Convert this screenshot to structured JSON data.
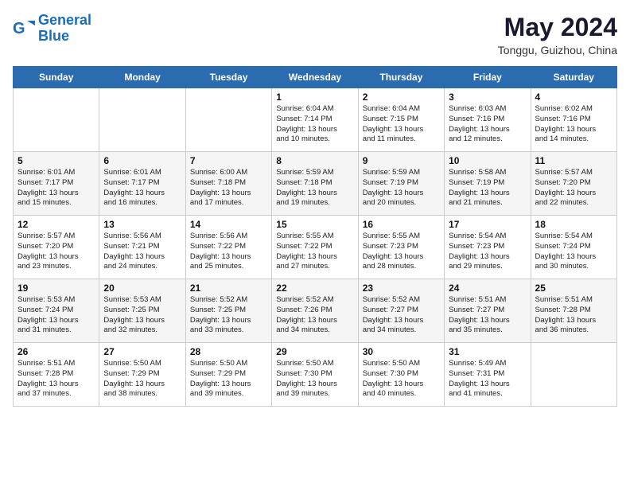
{
  "header": {
    "logo_general": "General",
    "logo_blue": "Blue",
    "month_year": "May 2024",
    "location": "Tonggu, Guizhou, China"
  },
  "weekdays": [
    "Sunday",
    "Monday",
    "Tuesday",
    "Wednesday",
    "Thursday",
    "Friday",
    "Saturday"
  ],
  "weeks": [
    [
      {
        "day": "",
        "info": ""
      },
      {
        "day": "",
        "info": ""
      },
      {
        "day": "",
        "info": ""
      },
      {
        "day": "1",
        "info": "Sunrise: 6:04 AM\nSunset: 7:14 PM\nDaylight: 13 hours\nand 10 minutes."
      },
      {
        "day": "2",
        "info": "Sunrise: 6:04 AM\nSunset: 7:15 PM\nDaylight: 13 hours\nand 11 minutes."
      },
      {
        "day": "3",
        "info": "Sunrise: 6:03 AM\nSunset: 7:16 PM\nDaylight: 13 hours\nand 12 minutes."
      },
      {
        "day": "4",
        "info": "Sunrise: 6:02 AM\nSunset: 7:16 PM\nDaylight: 13 hours\nand 14 minutes."
      }
    ],
    [
      {
        "day": "5",
        "info": "Sunrise: 6:01 AM\nSunset: 7:17 PM\nDaylight: 13 hours\nand 15 minutes."
      },
      {
        "day": "6",
        "info": "Sunrise: 6:01 AM\nSunset: 7:17 PM\nDaylight: 13 hours\nand 16 minutes."
      },
      {
        "day": "7",
        "info": "Sunrise: 6:00 AM\nSunset: 7:18 PM\nDaylight: 13 hours\nand 17 minutes."
      },
      {
        "day": "8",
        "info": "Sunrise: 5:59 AM\nSunset: 7:18 PM\nDaylight: 13 hours\nand 19 minutes."
      },
      {
        "day": "9",
        "info": "Sunrise: 5:59 AM\nSunset: 7:19 PM\nDaylight: 13 hours\nand 20 minutes."
      },
      {
        "day": "10",
        "info": "Sunrise: 5:58 AM\nSunset: 7:19 PM\nDaylight: 13 hours\nand 21 minutes."
      },
      {
        "day": "11",
        "info": "Sunrise: 5:57 AM\nSunset: 7:20 PM\nDaylight: 13 hours\nand 22 minutes."
      }
    ],
    [
      {
        "day": "12",
        "info": "Sunrise: 5:57 AM\nSunset: 7:20 PM\nDaylight: 13 hours\nand 23 minutes."
      },
      {
        "day": "13",
        "info": "Sunrise: 5:56 AM\nSunset: 7:21 PM\nDaylight: 13 hours\nand 24 minutes."
      },
      {
        "day": "14",
        "info": "Sunrise: 5:56 AM\nSunset: 7:22 PM\nDaylight: 13 hours\nand 25 minutes."
      },
      {
        "day": "15",
        "info": "Sunrise: 5:55 AM\nSunset: 7:22 PM\nDaylight: 13 hours\nand 27 minutes."
      },
      {
        "day": "16",
        "info": "Sunrise: 5:55 AM\nSunset: 7:23 PM\nDaylight: 13 hours\nand 28 minutes."
      },
      {
        "day": "17",
        "info": "Sunrise: 5:54 AM\nSunset: 7:23 PM\nDaylight: 13 hours\nand 29 minutes."
      },
      {
        "day": "18",
        "info": "Sunrise: 5:54 AM\nSunset: 7:24 PM\nDaylight: 13 hours\nand 30 minutes."
      }
    ],
    [
      {
        "day": "19",
        "info": "Sunrise: 5:53 AM\nSunset: 7:24 PM\nDaylight: 13 hours\nand 31 minutes."
      },
      {
        "day": "20",
        "info": "Sunrise: 5:53 AM\nSunset: 7:25 PM\nDaylight: 13 hours\nand 32 minutes."
      },
      {
        "day": "21",
        "info": "Sunrise: 5:52 AM\nSunset: 7:25 PM\nDaylight: 13 hours\nand 33 minutes."
      },
      {
        "day": "22",
        "info": "Sunrise: 5:52 AM\nSunset: 7:26 PM\nDaylight: 13 hours\nand 34 minutes."
      },
      {
        "day": "23",
        "info": "Sunrise: 5:52 AM\nSunset: 7:27 PM\nDaylight: 13 hours\nand 34 minutes."
      },
      {
        "day": "24",
        "info": "Sunrise: 5:51 AM\nSunset: 7:27 PM\nDaylight: 13 hours\nand 35 minutes."
      },
      {
        "day": "25",
        "info": "Sunrise: 5:51 AM\nSunset: 7:28 PM\nDaylight: 13 hours\nand 36 minutes."
      }
    ],
    [
      {
        "day": "26",
        "info": "Sunrise: 5:51 AM\nSunset: 7:28 PM\nDaylight: 13 hours\nand 37 minutes."
      },
      {
        "day": "27",
        "info": "Sunrise: 5:50 AM\nSunset: 7:29 PM\nDaylight: 13 hours\nand 38 minutes."
      },
      {
        "day": "28",
        "info": "Sunrise: 5:50 AM\nSunset: 7:29 PM\nDaylight: 13 hours\nand 39 minutes."
      },
      {
        "day": "29",
        "info": "Sunrise: 5:50 AM\nSunset: 7:30 PM\nDaylight: 13 hours\nand 39 minutes."
      },
      {
        "day": "30",
        "info": "Sunrise: 5:50 AM\nSunset: 7:30 PM\nDaylight: 13 hours\nand 40 minutes."
      },
      {
        "day": "31",
        "info": "Sunrise: 5:49 AM\nSunset: 7:31 PM\nDaylight: 13 hours\nand 41 minutes."
      },
      {
        "day": "",
        "info": ""
      }
    ]
  ]
}
